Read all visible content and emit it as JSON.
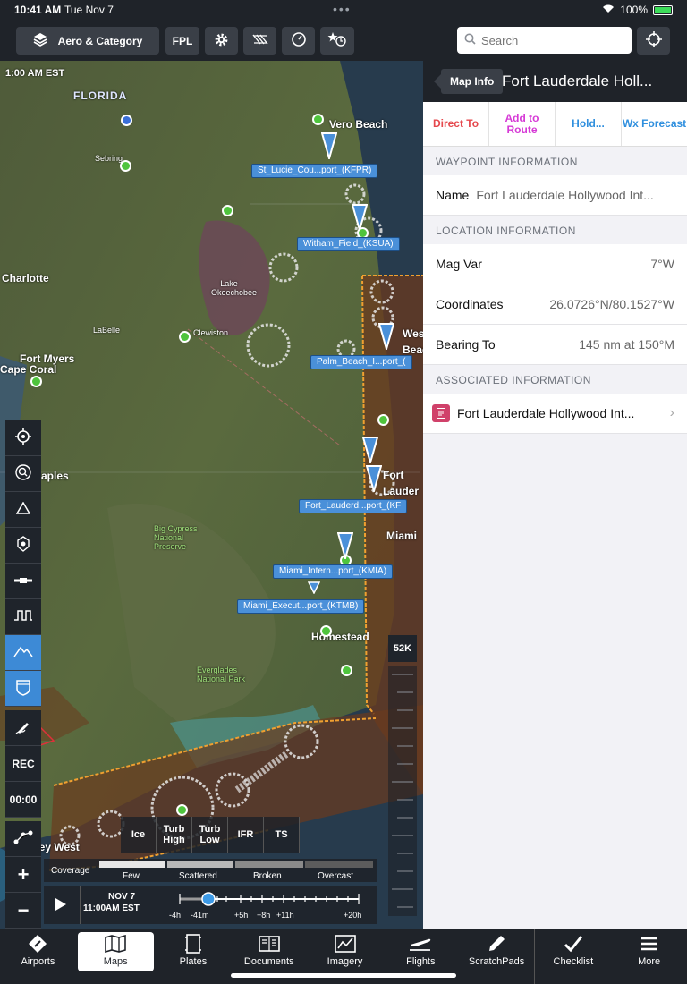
{
  "status": {
    "time": "10:41 AM",
    "date": "Tue Nov 7",
    "battery": "100%"
  },
  "toolbar": {
    "layers_label": "Aero & Category",
    "fpl_label": "FPL",
    "search_placeholder": "Search"
  },
  "map": {
    "timestamp": "1:00 AM EST",
    "places": {
      "florida": "FLORIDA",
      "vero_beach": "Vero Beach",
      "charlotte": "Charlotte",
      "fort_myers": "Fort Myers",
      "cape_coral": "Cape Coral",
      "naples": "aples",
      "west_beach": "West",
      "beach": "Beach",
      "fort": "Fort",
      "lauderdale": "Lauder",
      "miami": "Miami",
      "homestead": "Homestead",
      "key_west": "Key West",
      "sebring": "Sebring",
      "lake_okeechobee": "Lake Okeechobee",
      "clewiston": "Clewiston",
      "labelle": "LaBelle",
      "everglades": "Everglades National Park",
      "big_cypress": "Big Cypress National Preserve"
    },
    "waypoints": [
      "St_Lucie_Cou...port_(KFPR)",
      "Witham_Field_(KSUA)",
      "Palm_Beach_I...port_(",
      "Fort_Lauderd...port_(KF",
      "Miami_Intern...port_(KMIA)",
      "Miami_Execut...port_(KTMB)"
    ],
    "altitude": "52K",
    "side_tools": {
      "rec": "REC",
      "timer": "00:00"
    },
    "wx_buttons": [
      "Ice",
      "Turb High",
      "Turb Low",
      "IFR",
      "TS"
    ],
    "coverage": {
      "label": "Coverage",
      "levels": [
        "Few",
        "Scattered",
        "Broken",
        "Overcast"
      ]
    },
    "timeline": {
      "date": "NOV 7",
      "time": "11:00AM EST",
      "ticks": [
        "-4h",
        "-41m",
        "+5h",
        "+8h",
        "+11h",
        "+20h"
      ]
    }
  },
  "panel": {
    "back_label": "Map Info",
    "title": "Fort Lauderdale Holl...",
    "actions": [
      {
        "label": "Direct To",
        "color": "#e5484d"
      },
      {
        "label": "Add to Route",
        "color": "#d63ad6"
      },
      {
        "label": "Hold...",
        "color": "#2f8fde"
      },
      {
        "label": "Wx Forecast",
        "color": "#2f8fde"
      }
    ],
    "sections": {
      "waypoint": "WAYPOINT INFORMATION",
      "location": "LOCATION INFORMATION",
      "associated": "ASSOCIATED INFORMATION"
    },
    "name_label": "Name",
    "name_value": "Fort Lauderdale Hollywood Int...",
    "magvar_label": "Mag Var",
    "magvar_value": "7°W",
    "coords_label": "Coordinates",
    "coords_value": "26.0726°N/80.1527°W",
    "bearing_label": "Bearing To",
    "bearing_value": "145 nm at 150°M",
    "assoc_item": "Fort Lauderdale Hollywood Int..."
  },
  "tabs": [
    "Airports",
    "Maps",
    "Plates",
    "Documents",
    "Imagery",
    "Flights",
    "ScratchPads",
    "Checklist",
    "More"
  ],
  "colors": {
    "accent": "#4a90d9",
    "airport_green": "#4fc43d",
    "active_tool": "#3d8ad6"
  }
}
